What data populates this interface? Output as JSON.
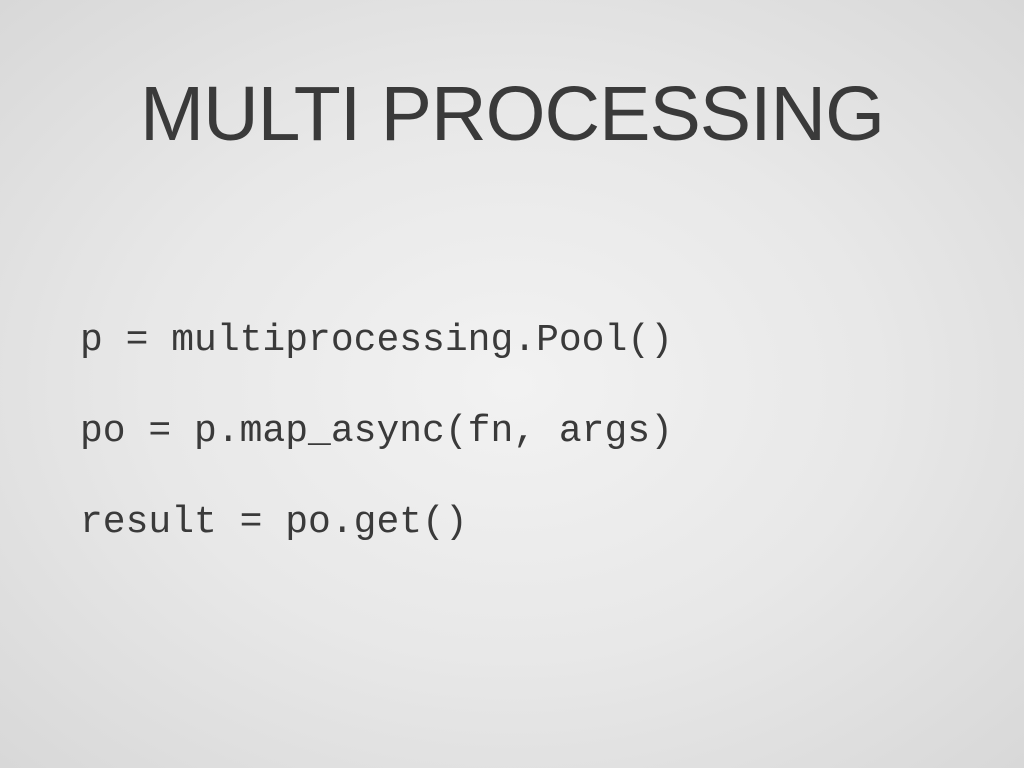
{
  "slide": {
    "title": "MULTI PROCESSING",
    "code": {
      "line1": "p = multiprocessing.Pool()",
      "line2": "po = p.map_async(fn, args)",
      "line3": "result = po.get()"
    }
  }
}
